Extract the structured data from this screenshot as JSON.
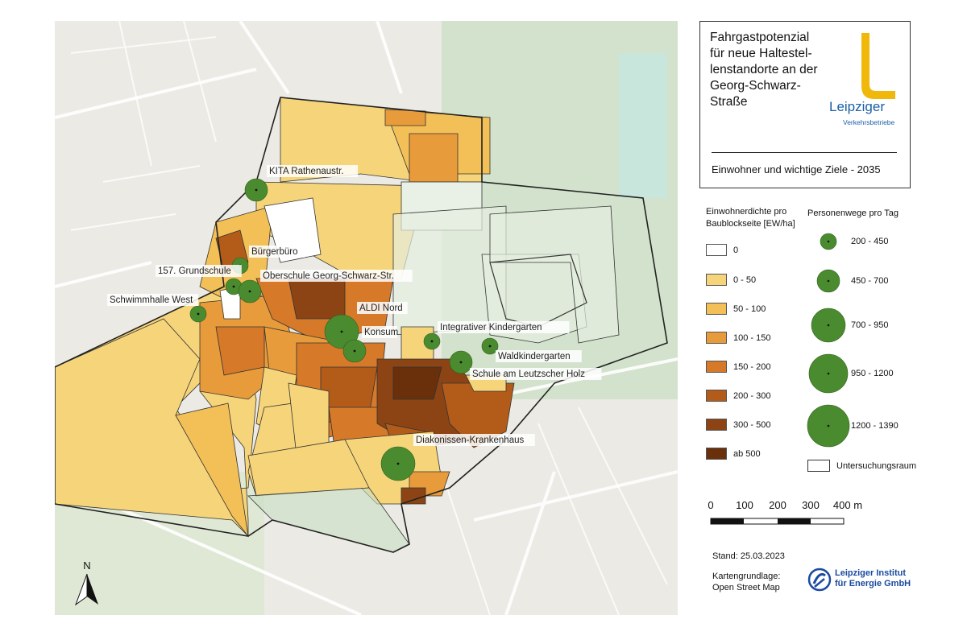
{
  "title": "Fahrgastpotenzial für neue Haltestel-lenstandorte an der Georg-Schwarz-Straße",
  "title_lines": [
    "Fahrgastpotenzial",
    "für neue Haltestel-",
    "lenstandorte an der",
    "Georg-Schwarz-",
    "Straße"
  ],
  "logo": {
    "name": "Leipziger",
    "sub": "Verkehrsbetriebe",
    "color": "#f1b80c",
    "text_color": "#1a5fa6"
  },
  "subtitle": "Einwohner und wichtige Ziele - 2035",
  "density_legend": {
    "heading_lines": [
      "Einwohnerdichte pro",
      "Baublockseite [EW/ha]"
    ],
    "classes": [
      {
        "label": "0",
        "color": "#ffffff"
      },
      {
        "label": "0 - 50",
        "color": "#f6d47a"
      },
      {
        "label": "50 - 100",
        "color": "#f3bf57"
      },
      {
        "label": "100 - 150",
        "color": "#e89b3a"
      },
      {
        "label": "150 - 200",
        "color": "#d67a2a"
      },
      {
        "label": "200 - 300",
        "color": "#b35c1a"
      },
      {
        "label": "300 - 500",
        "color": "#8c4414"
      },
      {
        "label": "ab 500",
        "color": "#6a300c"
      }
    ]
  },
  "trips_legend": {
    "heading": "Personenwege pro Tag",
    "color": "#4b8b2f",
    "classes": [
      {
        "label": "200 - 450",
        "size_class": 1
      },
      {
        "label": "450 - 700",
        "size_class": 2
      },
      {
        "label": "700 - 950",
        "size_class": 3
      },
      {
        "label": "950 - 1200",
        "size_class": 4
      },
      {
        "label": "1200 - 1390",
        "size_class": 5
      }
    ]
  },
  "study_area_label": "Untersuchungsraum",
  "scale_bar": {
    "labels": [
      "0",
      "100",
      "200",
      "300",
      "400 m"
    ]
  },
  "date_label": "Stand: 25.03.2023",
  "basemap_lines": [
    "Kartengrundlage:",
    "Open Street Map"
  ],
  "institute_lines": [
    "Leipziger Institut",
    "für Energie GmbH"
  ],
  "north_label": "N",
  "pois": [
    {
      "name": "KITA Rathenaustr.",
      "size_class": 2
    },
    {
      "name": "Bürgerbüro",
      "size_class": 1
    },
    {
      "name": "157. Grundschule",
      "size_class": 1
    },
    {
      "name": "Oberschule Georg-Schwarz-Str.",
      "size_class": 2
    },
    {
      "name": "Schwimmhalle West",
      "size_class": 1
    },
    {
      "name": "ALDI Nord",
      "size_class": 3
    },
    {
      "name": "Konsum",
      "size_class": 2
    },
    {
      "name": "Integrativer Kindergarten",
      "size_class": 1
    },
    {
      "name": "Waldkindergarten",
      "size_class": 1
    },
    {
      "name": "Schule am Leutzscher Holz",
      "size_class": 2
    },
    {
      "name": "Diakonissen-Krankenhaus",
      "size_class": 3
    }
  ]
}
